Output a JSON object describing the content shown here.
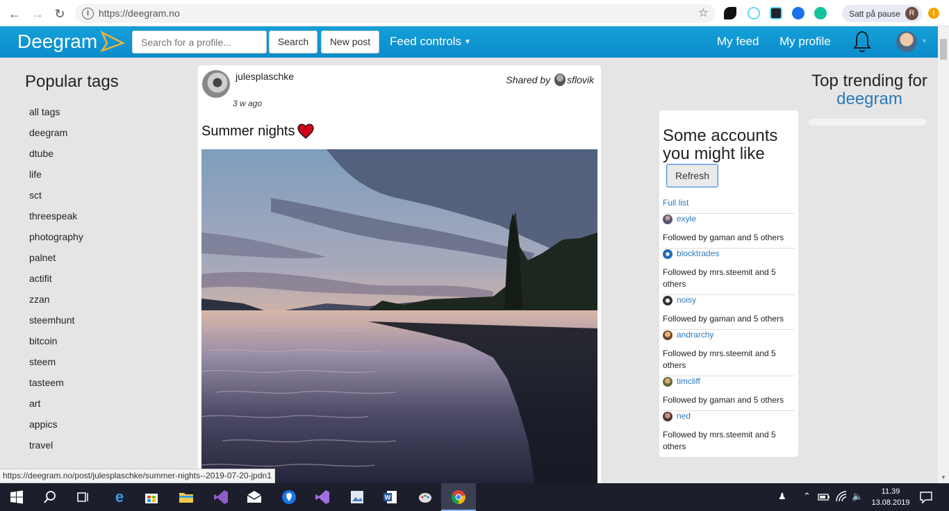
{
  "browser": {
    "url": "https://deegram.no",
    "pause_label": "Satt på pause",
    "user_initial": "R",
    "alert": "!"
  },
  "nav": {
    "brand": "Deegram",
    "search_placeholder": "Search for a profile...",
    "search_button": "Search",
    "new_post_button": "New post",
    "feed_controls": "Feed controls",
    "my_feed": "My feed",
    "my_profile": "My profile"
  },
  "sidebar": {
    "title": "Popular tags",
    "tags": [
      "all tags",
      "deegram",
      "dtube",
      "life",
      "sct",
      "threespeak",
      "photography",
      "palnet",
      "actifit",
      "zzan",
      "steemhunt",
      "bitcoin",
      "steem",
      "tasteem",
      "art",
      "appics",
      "travel"
    ]
  },
  "post": {
    "author": "julesplaschke",
    "time": "3 w ago",
    "shared_by_label": "Shared by",
    "shared_by_user": "sflovik",
    "title": "Summer nights"
  },
  "suggestions": {
    "title": "Some accounts you might like",
    "refresh_button": "Refresh",
    "full_list": "Full list",
    "accounts": [
      {
        "name": "exyle",
        "followed_by": "Followed by gaman and 5 others"
      },
      {
        "name": "blocktrades",
        "followed_by": "Followed by mrs.steemit and 5 others"
      },
      {
        "name": "noisy",
        "followed_by": "Followed by gaman and 5 others"
      },
      {
        "name": "andrarchy",
        "followed_by": "Followed by mrs.steemit and 5 others"
      },
      {
        "name": "timcliff",
        "followed_by": "Followed by gaman and 5 others"
      },
      {
        "name": "ned",
        "followed_by": "Followed by mrs.steemit and 5 others"
      }
    ]
  },
  "trending": {
    "title": "Top trending for",
    "tag": "deegram"
  },
  "status_url": "https://deegram.no/post/julesplaschke/summer-nights--2019-07-20-jpdn1",
  "taskbar": {
    "time": "11.39",
    "date": "13.08.2019"
  },
  "colors": {
    "nav_bg": "#0c8ccb",
    "link": "#2a7ab8",
    "heart": "#d0021b"
  }
}
